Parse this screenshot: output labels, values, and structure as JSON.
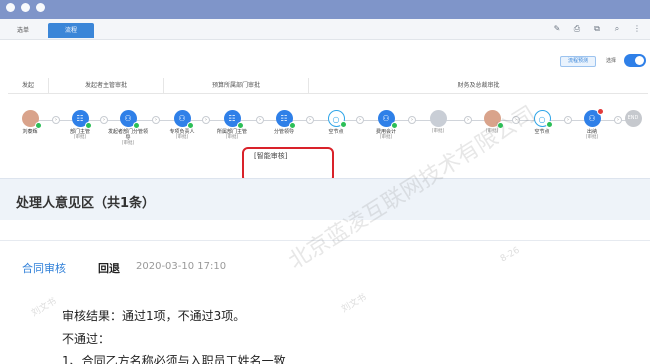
{
  "tabs": {
    "basic": "选单",
    "flow": "流程"
  },
  "toolbar": {
    "predict_label": "流程预测",
    "toggle_label": "选择"
  },
  "stages": [
    "发起",
    "发起者主管审批",
    "预算所属部门审批",
    "财务及总裁审批"
  ],
  "nodes": [
    {
      "label": "刘泰辉",
      "sub": ""
    },
    {
      "label": "部门主管",
      "sub": "[审批]"
    },
    {
      "label": "发起者部门分管领导",
      "sub": "[审批]"
    },
    {
      "label": "专项负责人",
      "sub": "[审批]"
    },
    {
      "label": "所属部门主管",
      "sub": "[审批]"
    },
    {
      "label": "分管领导",
      "sub": ""
    },
    {
      "label": "空节点",
      "sub": ""
    },
    {
      "label": "费用会计",
      "sub": "[审批]"
    },
    {
      "label": "",
      "sub": "[审批]"
    },
    {
      "label": "",
      "sub": "[审批]"
    },
    {
      "label": "空节点",
      "sub": ""
    },
    {
      "label": "出纳",
      "sub": "[审批]"
    },
    {
      "label": "END",
      "sub": ""
    }
  ],
  "smart_review": "[智能审核]",
  "opinion": {
    "title": "处理人意见区（共1条）",
    "contract_link": "合同审核",
    "return_tag": "回退",
    "time": "2020-03-10 17:10",
    "result": "审核结果：通过1项，不通过3项。",
    "fail": "不通过：",
    "item": "1、合同乙方名称必须与入职员工姓名一致"
  },
  "watermark": {
    "main": "北京蓝凌互联网技术有限公司",
    "name": "刘文书",
    "date": "8-26"
  }
}
